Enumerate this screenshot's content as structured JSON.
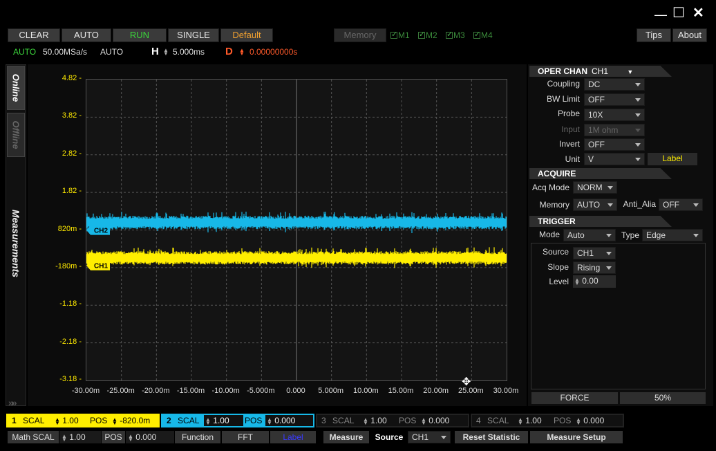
{
  "window": {
    "minimize": "—",
    "maximize": "☐",
    "close": "✕"
  },
  "toolbar": {
    "clear": "CLEAR",
    "auto": "AUTO",
    "run": "RUN",
    "single": "SINGLE",
    "default": "Default",
    "memory": "Memory",
    "m1": "M1",
    "m2": "M2",
    "m3": "M3",
    "m4": "M4",
    "tips": "Tips",
    "about": "About"
  },
  "status": {
    "mode": "AUTO",
    "rate": "50.00MSa/s",
    "acq": "AUTO",
    "h_label": "H",
    "h_value": "5.000ms",
    "d_label": "D",
    "d_value": "0.00000000s"
  },
  "tabs": {
    "online": "Online",
    "offline": "Offline",
    "measurements": "Measurements"
  },
  "colors": {
    "ch1": "#ffee00",
    "ch2": "#17b8e8",
    "run": "#3cd73c",
    "default": "#f0a030",
    "delay": "#ff5a2a"
  },
  "chart_data": {
    "type": "line",
    "y_ticks": [
      "4.82",
      "3.82",
      "2.82",
      "1.82",
      "820m",
      "-180m",
      "-1.18",
      "-2.18",
      "-3.18"
    ],
    "x_ticks": [
      "-30.00m",
      "-25.00m",
      "-20.00m",
      "-15.00m",
      "-10.00m",
      "-5.000m",
      "0.000",
      "5.000m",
      "10.00m",
      "15.00m",
      "20.00m",
      "25.00m",
      "30.00m"
    ],
    "ylim": [
      -3.18,
      4.82
    ],
    "xlim": [
      -30,
      30
    ],
    "grid": true,
    "series": [
      {
        "name": "CH2",
        "mean": 1.02,
        "noise": 0.18,
        "color": "#17b8e8"
      },
      {
        "name": "CH1",
        "mean": 0.08,
        "noise": 0.18,
        "color": "#ffee00"
      }
    ]
  },
  "oper": {
    "title": "OPER CHAN",
    "chan": "CH1",
    "coupling_label": "Coupling",
    "coupling": "DC",
    "bw_label": "BW Limit",
    "bw": "OFF",
    "probe_label": "Probe",
    "probe": "10X",
    "input_label": "Input",
    "input": "1M ohm",
    "invert_label": "Invert",
    "invert": "OFF",
    "unit_label": "Unit",
    "unit": "V",
    "label_btn": "Label"
  },
  "acquire": {
    "title": "ACQUIRE",
    "mode_label": "Acq Mode",
    "mode": "NORM",
    "memory_label": "Memory",
    "memory": "AUTO",
    "anti_label": "Anti_Alia",
    "anti": "OFF"
  },
  "trigger": {
    "title": "TRIGGER",
    "mode_label": "Mode",
    "mode": "Auto",
    "type_label": "Type",
    "type": "Edge",
    "source_label": "Source",
    "source": "CH1",
    "slope_label": "Slope",
    "slope": "Rising",
    "level_label": "Level",
    "level": "0.00",
    "force": "FORCE",
    "fifty": "50%"
  },
  "channels": [
    {
      "num": "1",
      "scal_label": "SCAL",
      "scal": "1.00",
      "pos_label": "POS",
      "pos": "-820.0m"
    },
    {
      "num": "2",
      "scal_label": "SCAL",
      "scal": "1.00",
      "pos_label": "POS",
      "pos": "0.000"
    },
    {
      "num": "3",
      "scal_label": "SCAL",
      "scal": "1.00",
      "pos_label": "POS",
      "pos": "0.000"
    },
    {
      "num": "4",
      "scal_label": "SCAL",
      "scal": "1.00",
      "pos_label": "POS",
      "pos": "0.000"
    }
  ],
  "bottom": {
    "math_scal_label": "Math SCAL",
    "math_scal": "1.00",
    "pos_label": "POS",
    "pos": "0.000",
    "function": "Function",
    "fft": "FFT",
    "label": "Label",
    "measure": "Measure",
    "source_label": "Source",
    "source": "CH1",
    "reset": "Reset  Statistic",
    "measure_setup": "Measure Setup"
  }
}
